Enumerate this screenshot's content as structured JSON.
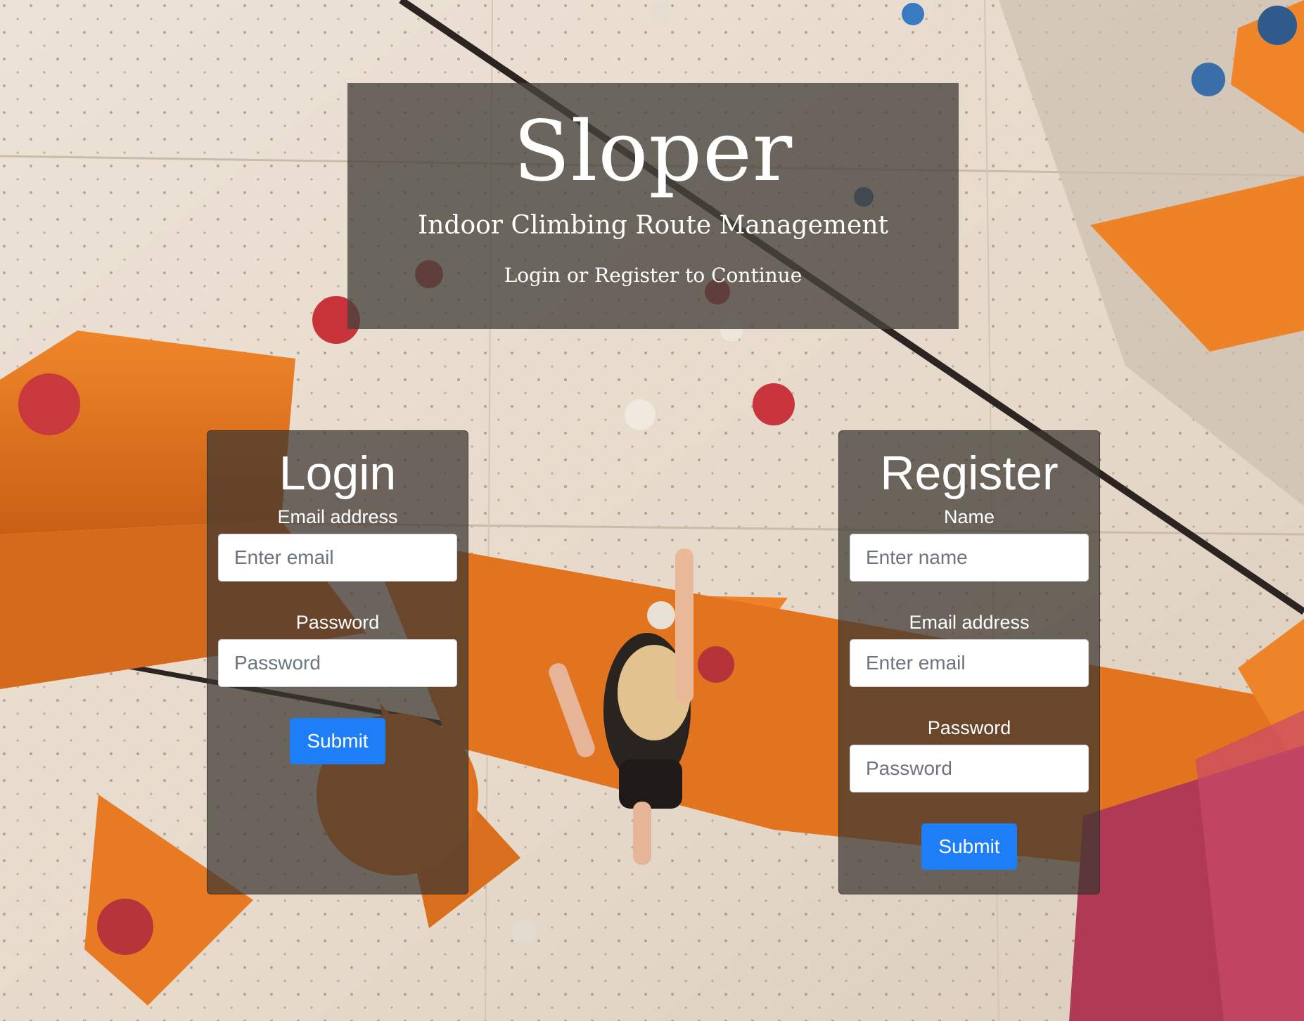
{
  "hero": {
    "title": "Sloper",
    "subtitle": "Indoor Climbing Route Management",
    "cta": "Login or Register to Continue"
  },
  "login": {
    "title": "Login",
    "email_label": "Email address",
    "email_placeholder": "Enter email",
    "password_label": "Password",
    "password_placeholder": "Password",
    "submit_label": "Submit"
  },
  "register": {
    "title": "Register",
    "name_label": "Name",
    "name_placeholder": "Enter name",
    "email_label": "Email address",
    "email_placeholder": "Enter email",
    "password_label": "Password",
    "password_placeholder": "Password",
    "submit_label": "Submit"
  },
  "colors": {
    "primary_button": "#1e7ef8",
    "panel_overlay": "rgba(60,54,48,0.72)",
    "hold_orange": "#e8731f",
    "hold_red": "#d23a3a",
    "wall": "#e8dccf"
  },
  "background": {
    "description_icon": "climbing-wall-photo"
  }
}
